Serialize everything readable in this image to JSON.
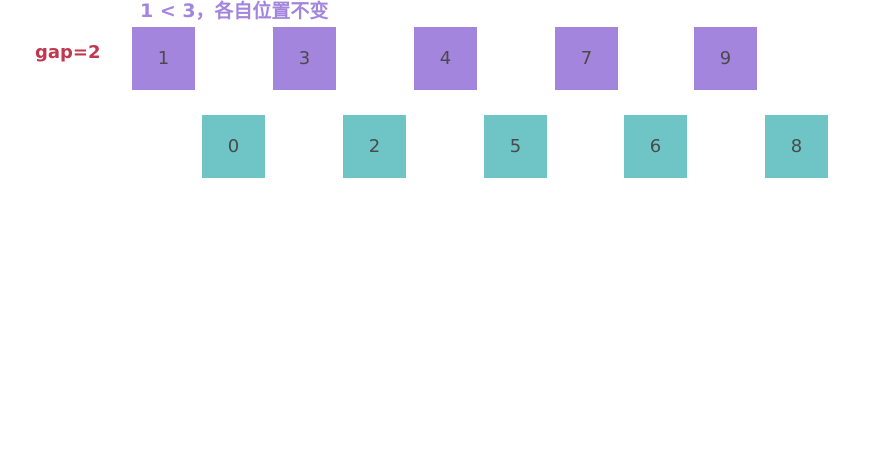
{
  "caption": "1 < 3，各自位置不变",
  "gap_label": "gap=2",
  "colors": {
    "top_row": "#a485dd",
    "bottom_row": "#6fc5c5",
    "caption": "#a485dd",
    "gap_label": "#c0384f"
  },
  "top_row": [
    "1",
    "3",
    "4",
    "7",
    "9"
  ],
  "bottom_row": [
    "0",
    "2",
    "5",
    "6",
    "8"
  ]
}
